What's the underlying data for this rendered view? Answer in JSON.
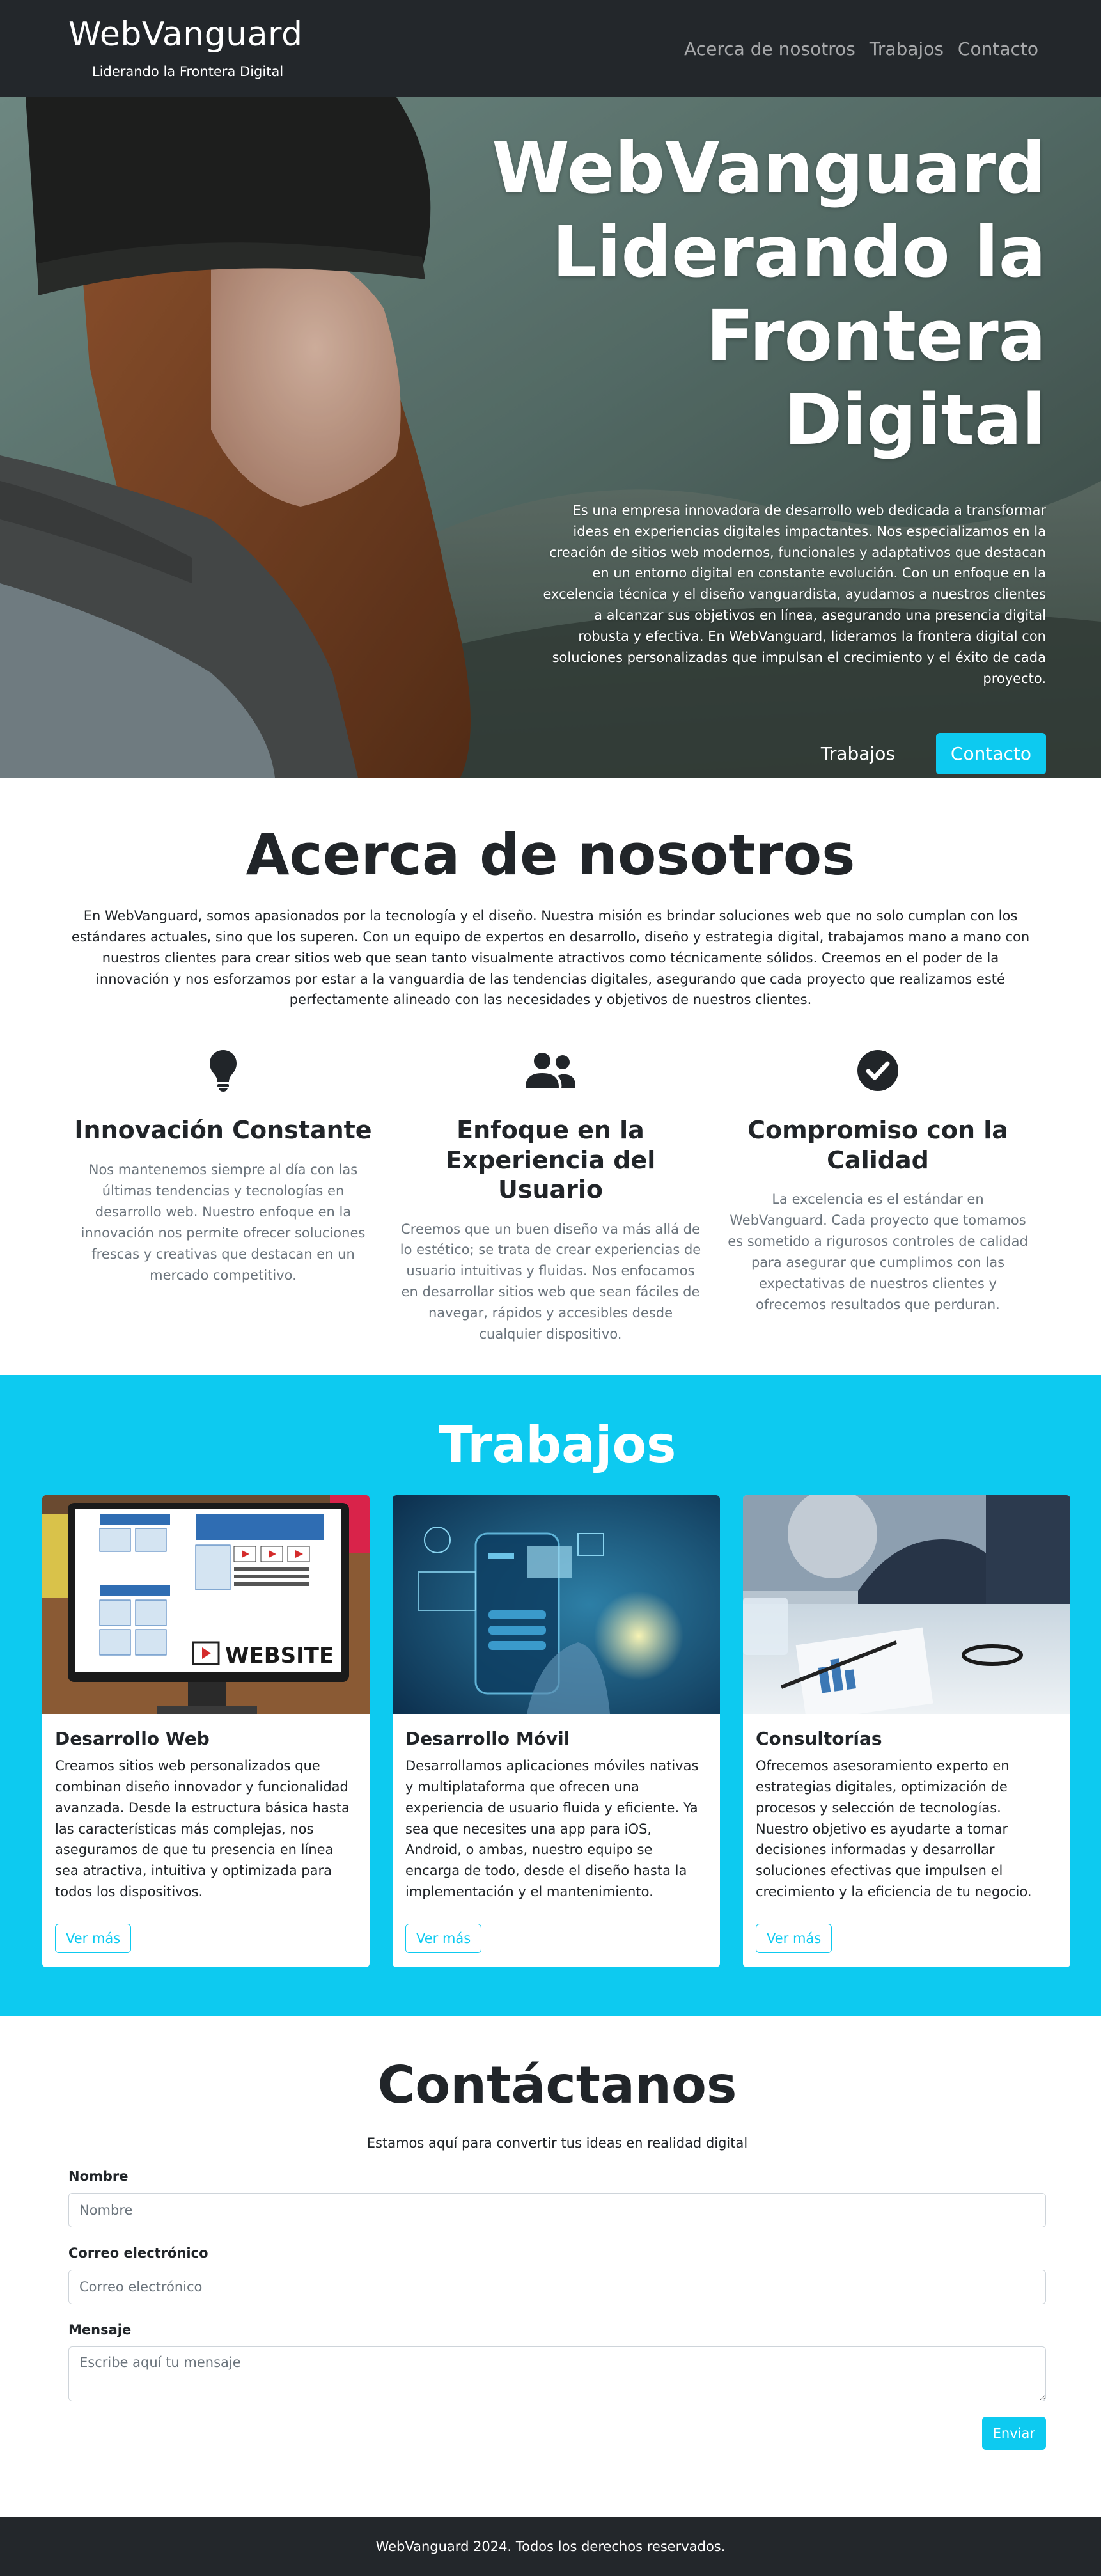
{
  "brand": {
    "name": "WebVanguard",
    "tagline": "Liderando la Frontera Digital"
  },
  "nav": [
    {
      "label": "Acerca de nosotros"
    },
    {
      "label": "Trabajos"
    },
    {
      "label": "Contacto"
    }
  ],
  "hero": {
    "title_line1": "WebVanguard",
    "title_line2": "Liderando la",
    "title_line3": "Frontera Digital",
    "text": "Es una empresa innovadora de desarrollo web dedicada a transformar ideas en experiencias digitales impactantes. Nos especializamos en la creación de sitios web modernos, funcionales y adaptativos que destacan en un entorno digital en constante evolución. Con un enfoque en la excelencia técnica y el diseño vanguardista, ayudamos a nuestros clientes a alcanzar sus objetivos en línea, asegurando una presencia digital robusta y efectiva. En WebVanguard, lideramos la frontera digital con soluciones personalizadas que impulsan el crecimiento y el éxito de cada proyecto.",
    "btn_works": "Trabajos",
    "btn_contact": "Contacto"
  },
  "about": {
    "title": "Acerca de nosotros",
    "text": "En WebVanguard, somos apasionados por la tecnología y el diseño. Nuestra misión es brindar soluciones web que no solo cumplan con los estándares actuales, sino que los superen. Con un equipo de expertos en desarrollo, diseño y estrategia digital, trabajamos mano a mano con nuestros clientes para crear sitios web que sean tanto visualmente atractivos como técnicamente sólidos. Creemos en el poder de la innovación y nos esforzamos por estar a la vanguardia de las tendencias digitales, asegurando que cada proyecto que realizamos esté perfectamente alineado con las necesidades y objetivos de nuestros clientes.",
    "features": [
      {
        "icon": "lightbulb-icon",
        "title": "Innovación Constante",
        "text": "Nos mantenemos siempre al día con las últimas tendencias y tecnologías en desarrollo web. Nuestro enfoque en la innovación nos permite ofrecer soluciones frescas y creativas que destacan en un mercado competitivo."
      },
      {
        "icon": "users-icon",
        "title": "Enfoque en la Experiencia del Usuario",
        "text": "Creemos que un buen diseño va más allá de lo estético; se trata de crear experiencias de usuario intuitivas y fluidas. Nos enfocamos en desarrollar sitios web que sean fáciles de navegar, rápidos y accesibles desde cualquier dispositivo."
      },
      {
        "icon": "check-circle-icon",
        "title": "Compromiso con la Calidad",
        "text": "La excelencia es el estándar en WebVanguard. Cada proyecto que tomamos es sometido a rigurosos controles de calidad para asegurar que cumplimos con las expectativas de nuestros clientes y ofrecemos resultados que perduran."
      }
    ]
  },
  "works": {
    "title": "Trabajos",
    "cards": [
      {
        "title": "Desarrollo Web",
        "text": "Creamos sitios web personalizados que combinan diseño innovador y funcionalidad avanzada. Desde la estructura básica hasta las características más complejas, nos aseguramos de que tu presencia en línea sea atractiva, intuitiva y optimizada para todos los dispositivos.",
        "button": "Ver más",
        "image_label": "WEBSITE"
      },
      {
        "title": "Desarrollo Móvil",
        "text": "Desarrollamos aplicaciones móviles nativas y multiplataforma que ofrecen una experiencia de usuario fluida y eficiente. Ya sea que necesites una app para iOS, Android, o ambas, nuestro equipo se encarga de todo, desde el diseño hasta la implementación y el mantenimiento.",
        "button": "Ver más"
      },
      {
        "title": "Consultorías",
        "text": "Ofrecemos asesoramiento experto en estrategias digitales, optimización de procesos y selección de tecnologías. Nuestro objetivo es ayudarte a tomar decisiones informadas y desarrollar soluciones efectivas que impulsen el crecimiento y la eficiencia de tu negocio.",
        "button": "Ver más"
      }
    ]
  },
  "contact": {
    "title": "Contáctanos",
    "subtitle": "Estamos aquí para convertir tus ideas en realidad digital",
    "name_label": "Nombre",
    "name_placeholder": "Nombre",
    "email_label": "Correo electrónico",
    "email_placeholder": "Correo electrónico",
    "message_label": "Mensaje",
    "message_placeholder": "Escribe aquí tu mensaje",
    "submit": "Enviar"
  },
  "footer": {
    "text": "WebVanguard 2024. Todos los derechos reservados."
  },
  "colors": {
    "accent": "#0dcaf0",
    "dark": "#23272b",
    "muted": "#6c757d"
  }
}
